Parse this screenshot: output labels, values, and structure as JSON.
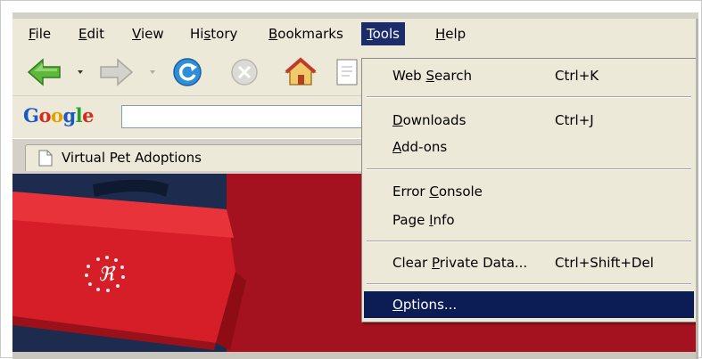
{
  "menubar": {
    "items": [
      {
        "pre": "",
        "ul": "F",
        "post": "ile"
      },
      {
        "pre": "",
        "ul": "E",
        "post": "dit"
      },
      {
        "pre": "",
        "ul": "V",
        "post": "iew"
      },
      {
        "pre": "Hi",
        "ul": "s",
        "post": "tory"
      },
      {
        "pre": "",
        "ul": "B",
        "post": "ookmarks"
      },
      {
        "pre": "",
        "ul": "T",
        "post": "ools"
      },
      {
        "pre": "",
        "ul": "H",
        "post": "elp"
      }
    ]
  },
  "google_toolbar": {
    "logo": "Google",
    "search_value": ""
  },
  "tab": {
    "title": "Virtual Pet Adoptions"
  },
  "tools_menu": {
    "items": [
      {
        "pre": "Web ",
        "ul": "S",
        "post": "earch",
        "shortcut": "Ctrl+K"
      },
      {
        "pre": "",
        "ul": "D",
        "post": "ownloads",
        "shortcut": "Ctrl+J"
      },
      {
        "pre": "",
        "ul": "A",
        "post": "dd-ons",
        "shortcut": ""
      },
      {
        "pre": "Error ",
        "ul": "C",
        "post": "onsole",
        "shortcut": ""
      },
      {
        "pre": "Page ",
        "ul": "I",
        "post": "nfo",
        "shortcut": ""
      },
      {
        "pre": "Clear ",
        "ul": "P",
        "post": "rivate Data...",
        "shortcut": "Ctrl+Shift+Del"
      },
      {
        "pre": "",
        "ul": "O",
        "post": "ptions...",
        "shortcut": ""
      }
    ],
    "highlighted_color": "#0c1c55"
  },
  "colors": {
    "active_menu": "#1c2b6b",
    "page_red": "#a5121f",
    "page_navy": "#1d2b4e",
    "chrome": "#ece9d8"
  },
  "icons": {
    "back": "back-arrow-icon",
    "forward": "forward-arrow-icon",
    "reload": "reload-icon",
    "stop": "stop-icon",
    "home": "home-icon",
    "page": "page-icon"
  }
}
